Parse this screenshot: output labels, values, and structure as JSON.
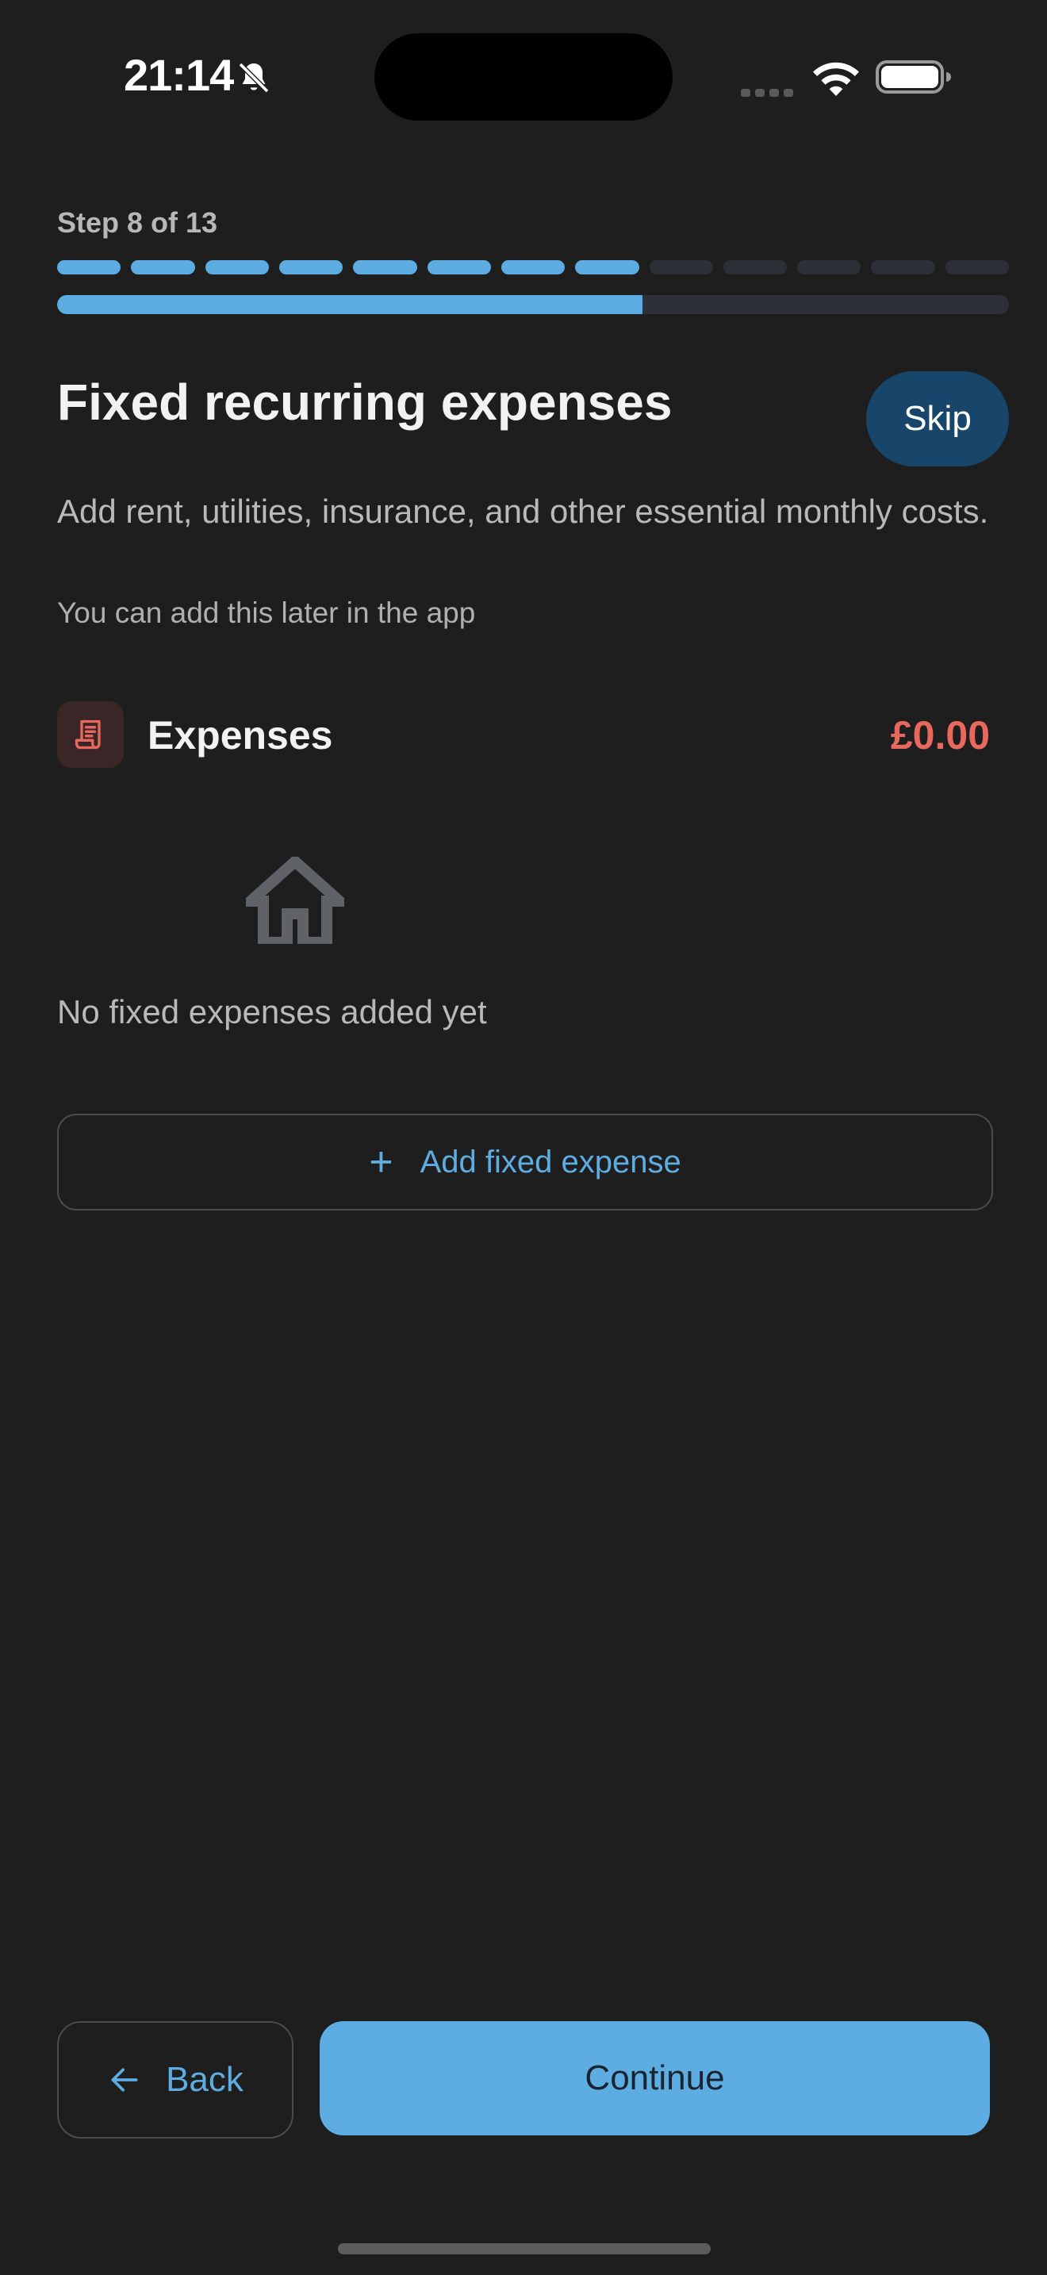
{
  "status_bar": {
    "time": "21:14",
    "icons": [
      "bell-slash-icon",
      "cellular-signal-icon",
      "wifi-icon",
      "battery-icon"
    ]
  },
  "onboarding": {
    "step_label": "Step 8 of 13",
    "current_step": 8,
    "total_steps": 13,
    "progress_fraction": 0.615
  },
  "header": {
    "title": "Fixed recurring expenses",
    "skip_label": "Skip",
    "subtitle": "Add rent, utilities, insurance, and other essential monthly costs.",
    "hint": "You can add this later in the app"
  },
  "expenses": {
    "icon": "receipt-icon",
    "label": "Expenses",
    "total": "£0.00",
    "empty_icon": "house-icon",
    "empty_text": "No fixed expenses added yet",
    "add_label": "Add fixed expense"
  },
  "footer": {
    "back_label": "Back",
    "continue_label": "Continue"
  },
  "colors": {
    "background": "#1e1e1e",
    "accent": "#5dade2",
    "expense_red": "#e8685d",
    "skip_bg": "#17466a",
    "track": "#2d3036"
  }
}
